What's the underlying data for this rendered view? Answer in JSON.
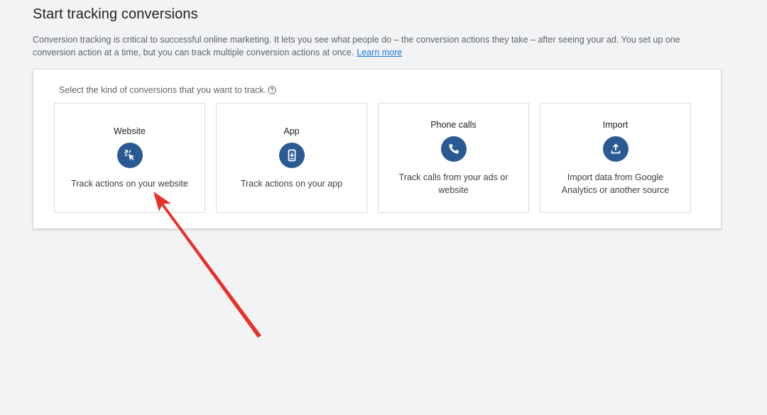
{
  "page": {
    "title": "Start tracking conversions",
    "intro_text": "Conversion tracking is critical to successful online marketing. It lets you see what people do – the conversion actions they take – after seeing your ad. You set up one conversion action at a time, but you can track multiple conversion actions at once.",
    "learn_more_label": "Learn more"
  },
  "selector": {
    "prompt": "Select the kind of conversions that you want to track.",
    "options": [
      {
        "title": "Website",
        "description": "Track actions on your website",
        "icon": "cursor-click-icon"
      },
      {
        "title": "App",
        "description": "Track actions on your app",
        "icon": "phone-download-icon"
      },
      {
        "title": "Phone calls",
        "description": "Track calls from your ads or website",
        "icon": "phone-icon"
      },
      {
        "title": "Import",
        "description": "Import data from Google Analytics or another source",
        "icon": "upload-icon"
      }
    ]
  },
  "colors": {
    "icon_background": "#2a5a94",
    "link": "#1a73e8",
    "annotation_arrow": "#e8302a"
  }
}
